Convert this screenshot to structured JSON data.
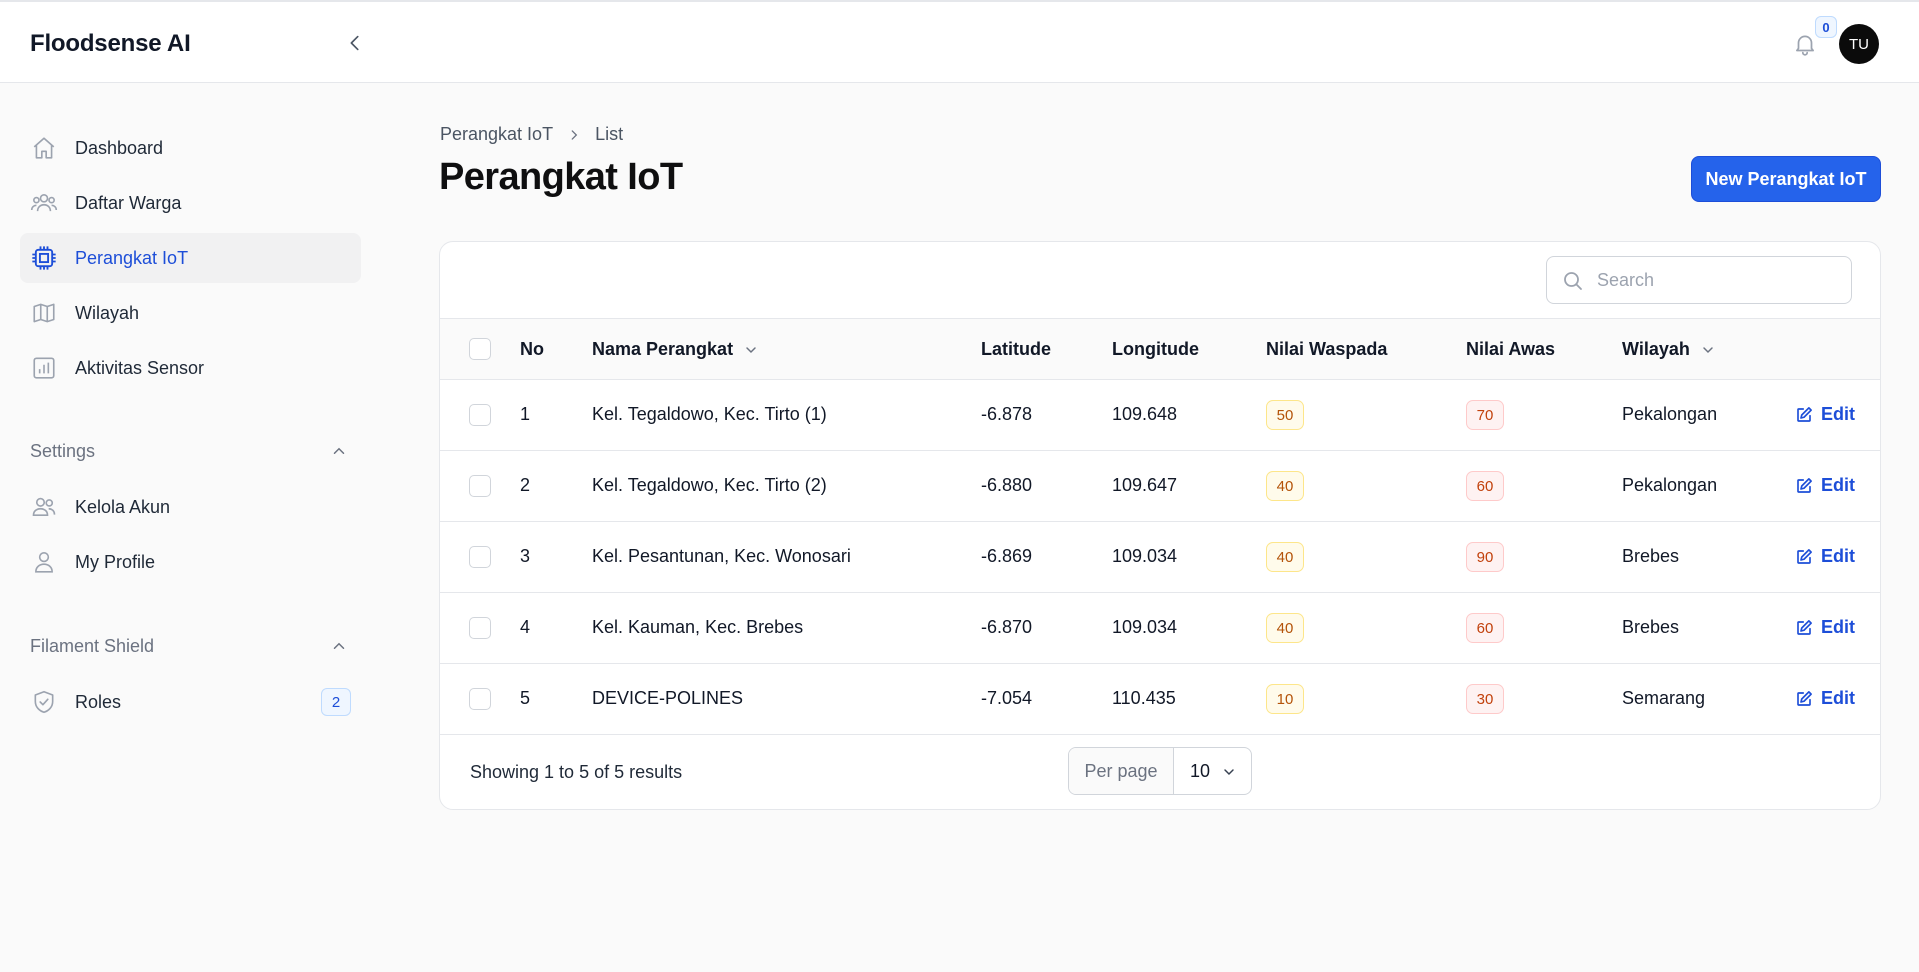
{
  "app": {
    "title": "Floodsense AI"
  },
  "header": {
    "notification_count": "0",
    "avatar_initials": "TU"
  },
  "sidebar": {
    "items": [
      {
        "label": "Dashboard",
        "icon": "home-icon"
      },
      {
        "label": "Daftar Warga",
        "icon": "users-icon"
      },
      {
        "label": "Perangkat IoT",
        "icon": "cpu-chip-icon",
        "active": true
      },
      {
        "label": "Wilayah",
        "icon": "map-icon"
      },
      {
        "label": "Aktivitas Sensor",
        "icon": "chart-bar-icon"
      }
    ],
    "groups": [
      {
        "label": "Settings",
        "items": [
          {
            "label": "Kelola Akun",
            "icon": "users-icon"
          },
          {
            "label": "My Profile",
            "icon": "user-icon"
          }
        ]
      },
      {
        "label": "Filament Shield",
        "items": [
          {
            "label": "Roles",
            "icon": "shield-check-icon",
            "badge": "2"
          }
        ]
      }
    ]
  },
  "breadcrumb": {
    "parent": "Perangkat IoT",
    "current": "List"
  },
  "page": {
    "title": "Perangkat IoT",
    "new_button": "New Perangkat IoT"
  },
  "table": {
    "search_placeholder": "Search",
    "columns": {
      "no": "No",
      "name": "Nama Perangkat",
      "lat": "Latitude",
      "lng": "Longitude",
      "waspada": "Nilai Waspada",
      "awas": "Nilai Awas",
      "wilayah": "Wilayah"
    },
    "edit_label": "Edit",
    "rows": [
      {
        "no": "1",
        "name": "Kel. Tegaldowo, Kec. Tirto (1)",
        "lat": "-6.878",
        "lng": "109.648",
        "waspada": "50",
        "awas": "70",
        "wilayah": "Pekalongan"
      },
      {
        "no": "2",
        "name": "Kel. Tegaldowo, Kec. Tirto (2)",
        "lat": "-6.880",
        "lng": "109.647",
        "waspada": "40",
        "awas": "60",
        "wilayah": "Pekalongan"
      },
      {
        "no": "3",
        "name": "Kel. Pesantunan, Kec. Wonosari",
        "lat": "-6.869",
        "lng": "109.034",
        "waspada": "40",
        "awas": "90",
        "wilayah": "Brebes"
      },
      {
        "no": "4",
        "name": "Kel. Kauman, Kec. Brebes",
        "lat": "-6.870",
        "lng": "109.034",
        "waspada": "40",
        "awas": "60",
        "wilayah": "Brebes"
      },
      {
        "no": "5",
        "name": "DEVICE-POLINES",
        "lat": "-7.054",
        "lng": "110.435",
        "waspada": "10",
        "awas": "30",
        "wilayah": "Semarang"
      }
    ],
    "footer": {
      "showing": "Showing 1 to 5 of 5 results",
      "per_page_label": "Per page",
      "per_page_value": "10"
    }
  },
  "colors": {
    "primary": "#2563eb",
    "warning": "#b45309",
    "danger": "#c2410c"
  }
}
